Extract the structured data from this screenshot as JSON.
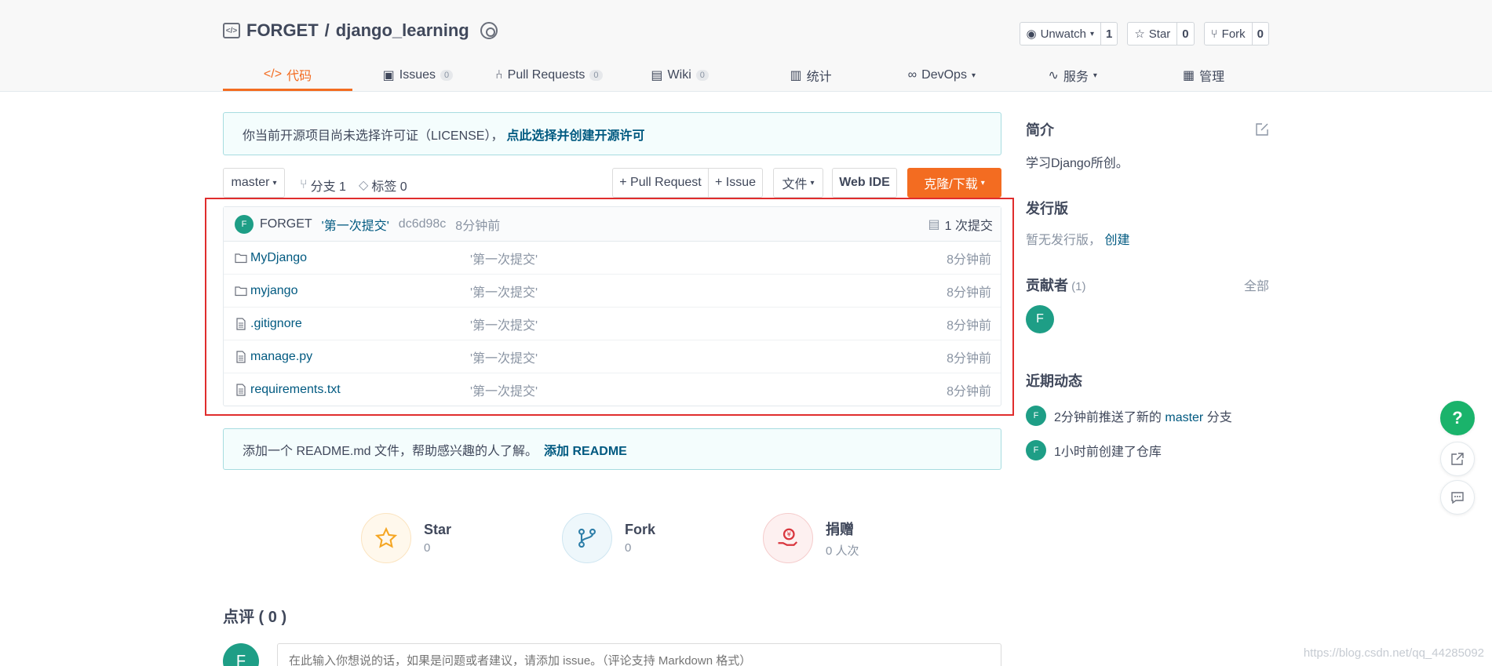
{
  "repo": {
    "owner": "FORGET",
    "separator": "/",
    "name": "django_learning"
  },
  "actions": [
    {
      "label": "Unwatch",
      "count": "1"
    },
    {
      "label": "Star",
      "count": "0"
    },
    {
      "label": "Fork",
      "count": "0"
    }
  ],
  "nav": [
    {
      "label": "代码",
      "count": ""
    },
    {
      "label": "Issues",
      "count": "0"
    },
    {
      "label": "Pull Requests",
      "count": "0"
    },
    {
      "label": "Wiki",
      "count": "0"
    },
    {
      "label": "统计",
      "count": ""
    },
    {
      "label": "DevOps",
      "count": ""
    },
    {
      "label": "服务",
      "count": ""
    },
    {
      "label": "管理",
      "count": ""
    }
  ],
  "license": {
    "text": "你当前开源项目尚未选择许可证（LICENSE），",
    "link": "点此选择并创建开源许可"
  },
  "toolbar": {
    "branch": "master",
    "branches": "分支 1",
    "tags": "标签 0",
    "pull_request": "+ Pull Request",
    "issue": "+ Issue",
    "file": "文件",
    "web_ide": "Web IDE",
    "clone": "克隆/下载"
  },
  "last_commit": {
    "avatar": "F",
    "author": "FORGET",
    "message": "'第一次提交'",
    "hash": "dc6d98c",
    "time": "8分钟前",
    "count": "1 次提交"
  },
  "files": [
    {
      "type": "folder",
      "name": "MyDjango",
      "message": "'第一次提交'",
      "time": "8分钟前"
    },
    {
      "type": "folder",
      "name": "myjango",
      "message": "'第一次提交'",
      "time": "8分钟前"
    },
    {
      "type": "file",
      "name": ".gitignore",
      "message": "'第一次提交'",
      "time": "8分钟前"
    },
    {
      "type": "file",
      "name": "manage.py",
      "message": "'第一次提交'",
      "time": "8分钟前"
    },
    {
      "type": "file",
      "name": "requirements.txt",
      "message": "'第一次提交'",
      "time": "8分钟前"
    }
  ],
  "readme": {
    "text": "添加一个 README.md 文件，帮助感兴趣的人了解。",
    "link": "添加 README"
  },
  "stats": [
    {
      "name": "Star",
      "value": "0"
    },
    {
      "name": "Fork",
      "value": "0"
    },
    {
      "name": "捐赠",
      "value": "0 人次"
    }
  ],
  "review": {
    "title": "点评 ( 0 )",
    "avatar": "F",
    "placeholder": "在此输入你想说的话，如果是问题或者建议，请添加 issue。（评论支持 Markdown 格式）"
  },
  "sidebar": {
    "intro_title": "简介",
    "intro_text": "学习Django所创。",
    "release_title": "发行版",
    "release_text": "暂无发行版，",
    "release_link": "创建",
    "contrib_title": "贡献者",
    "contrib_count": "(1)",
    "contrib_all": "全部",
    "contrib_avatar": "F",
    "activity_title": "近期动态",
    "activities": [
      {
        "avatar": "F",
        "pre": "2分钟前推送了新的",
        "branch": "master",
        "post": "分支"
      },
      {
        "avatar": "F",
        "pre": "1小时前创建了仓库",
        "branch": "",
        "post": ""
      }
    ]
  },
  "watermark": "https://blog.csdn.net/qq_44285092",
  "colors": {
    "accent": "#f36c21",
    "link": "#005980",
    "avatar": "#1e9e86",
    "highlight_box": "#e02d2d"
  }
}
